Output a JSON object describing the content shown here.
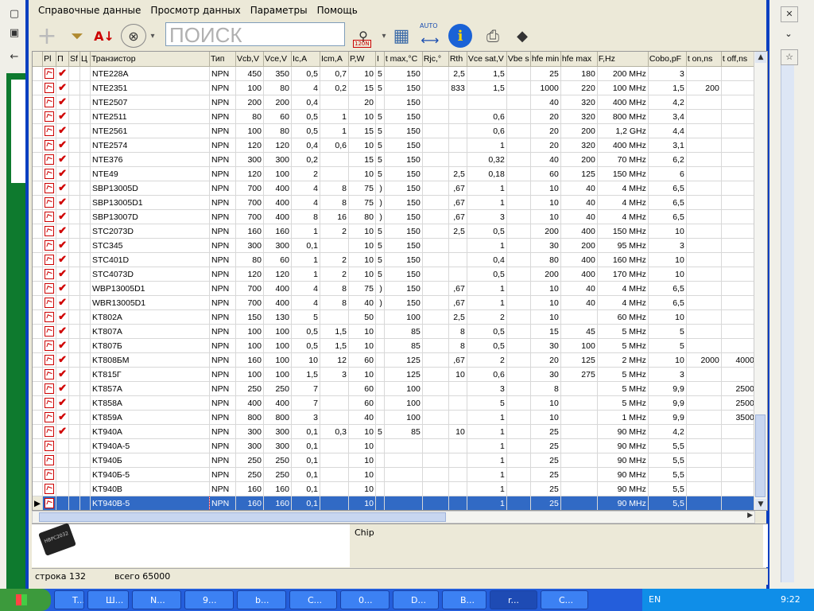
{
  "menu": [
    "Справочные данные",
    "Просмотр данных",
    "Параметры",
    "Помощь"
  ],
  "search_placeholder": "ПОИСК",
  "toolbar": {
    "auto_label": "AUTO",
    "filter_badge": "120N"
  },
  "columns": [
    "Pl",
    "П",
    "Sf",
    "Ц",
    "Транзистор",
    "Тип",
    "Vcb,V",
    "Vce,V",
    "Ic,A",
    "Icm,A",
    "P,W",
    "I",
    "t max,°C",
    "Rjc,°",
    "Rth",
    "Vce sat,V",
    "Vbe s",
    "hfe min",
    "hfe max",
    "F,Hz",
    "Cobo,pF",
    "t on,ns",
    "t off,ns"
  ],
  "rows": [
    {
      "n": "NTE228A",
      "t": "NPN",
      "vcb": "450",
      "vce": "350",
      "ic": "0,5",
      "icm": "0,7",
      "p": "10",
      "i": "5",
      "tmax": "150",
      "rjc": "",
      "rth": "2,5",
      "vsat": "1,5",
      "vbe": "",
      "hmin": "25",
      "hmax": "180",
      "f": "200 MHz",
      "cobo": "3",
      "ton": "",
      "toff": "",
      "ok": true
    },
    {
      "n": "NTE2351",
      "t": "NPN",
      "vcb": "100",
      "vce": "80",
      "ic": "4",
      "icm": "0,2",
      "p": "15",
      "i": "5",
      "tmax": "150",
      "rjc": "",
      "rth": "833",
      "vsat": "1,5",
      "vbe": "",
      "hmin": "1000",
      "hmax": "220",
      "f": "100 MHz",
      "cobo": "1,5",
      "ton": "200",
      "toff": "",
      "ok": true
    },
    {
      "n": "NTE2507",
      "t": "NPN",
      "vcb": "200",
      "vce": "200",
      "ic": "0,4",
      "icm": "",
      "p": "20",
      "i": "",
      "tmax": "150",
      "rjc": "",
      "rth": "",
      "vsat": "",
      "vbe": "",
      "hmin": "40",
      "hmax": "320",
      "f": "400 MHz",
      "cobo": "4,2",
      "ton": "",
      "toff": "",
      "ok": true
    },
    {
      "n": "NTE2511",
      "t": "NPN",
      "vcb": "80",
      "vce": "60",
      "ic": "0,5",
      "icm": "1",
      "p": "10",
      "i": "5",
      "tmax": "150",
      "rjc": "",
      "rth": "",
      "vsat": "0,6",
      "vbe": "",
      "hmin": "20",
      "hmax": "320",
      "f": "800 MHz",
      "cobo": "3,4",
      "ton": "",
      "toff": "",
      "ok": true
    },
    {
      "n": "NTE2561",
      "t": "NPN",
      "vcb": "100",
      "vce": "80",
      "ic": "0,5",
      "icm": "1",
      "p": "15",
      "i": "5",
      "tmax": "150",
      "rjc": "",
      "rth": "",
      "vsat": "0,6",
      "vbe": "",
      "hmin": "20",
      "hmax": "200",
      "f": "1,2 GHz",
      "cobo": "4,4",
      "ton": "",
      "toff": "",
      "ok": true
    },
    {
      "n": "NTE2574",
      "t": "NPN",
      "vcb": "120",
      "vce": "120",
      "ic": "0,4",
      "icm": "0,6",
      "p": "10",
      "i": "5",
      "tmax": "150",
      "rjc": "",
      "rth": "",
      "vsat": "1",
      "vbe": "",
      "hmin": "20",
      "hmax": "320",
      "f": "400 MHz",
      "cobo": "3,1",
      "ton": "",
      "toff": "",
      "ok": true
    },
    {
      "n": "NTE376",
      "t": "NPN",
      "vcb": "300",
      "vce": "300",
      "ic": "0,2",
      "icm": "",
      "p": "15",
      "i": "5",
      "tmax": "150",
      "rjc": "",
      "rth": "",
      "vsat": "0,32",
      "vbe": "",
      "hmin": "40",
      "hmax": "200",
      "f": "70 MHz",
      "cobo": "6,2",
      "ton": "",
      "toff": "",
      "ok": true
    },
    {
      "n": "NTE49",
      "t": "NPN",
      "vcb": "120",
      "vce": "100",
      "ic": "2",
      "icm": "",
      "p": "10",
      "i": "5",
      "tmax": "150",
      "rjc": "",
      "rth": "2,5",
      "vsat": "0,18",
      "vbe": "",
      "hmin": "60",
      "hmax": "125",
      "f": "150 MHz",
      "cobo": "6",
      "ton": "",
      "toff": "",
      "ok": true
    },
    {
      "n": "SBP13005D",
      "t": "NPN",
      "vcb": "700",
      "vce": "400",
      "ic": "4",
      "icm": "8",
      "p": "75",
      "i": ")",
      "tmax": "150",
      "rjc": "",
      "rth": ",67",
      "vsat": "1",
      "vbe": "",
      "hmin": "10",
      "hmax": "40",
      "f": "4 MHz",
      "cobo": "6,5",
      "ton": "",
      "toff": "",
      "ok": true
    },
    {
      "n": "SBP13005D1",
      "t": "NPN",
      "vcb": "700",
      "vce": "400",
      "ic": "4",
      "icm": "8",
      "p": "75",
      "i": ")",
      "tmax": "150",
      "rjc": "",
      "rth": ",67",
      "vsat": "1",
      "vbe": "",
      "hmin": "10",
      "hmax": "40",
      "f": "4 MHz",
      "cobo": "6,5",
      "ton": "",
      "toff": "",
      "ok": true
    },
    {
      "n": "SBP13007D",
      "t": "NPN",
      "vcb": "700",
      "vce": "400",
      "ic": "8",
      "icm": "16",
      "p": "80",
      "i": ")",
      "tmax": "150",
      "rjc": "",
      "rth": ",67",
      "vsat": "3",
      "vbe": "",
      "hmin": "10",
      "hmax": "40",
      "f": "4 MHz",
      "cobo": "6,5",
      "ton": "",
      "toff": "",
      "ok": true
    },
    {
      "n": "STC2073D",
      "t": "NPN",
      "vcb": "160",
      "vce": "160",
      "ic": "1",
      "icm": "2",
      "p": "10",
      "i": "5",
      "tmax": "150",
      "rjc": "",
      "rth": "2,5",
      "vsat": "0,5",
      "vbe": "",
      "hmin": "200",
      "hmax": "400",
      "f": "150 MHz",
      "cobo": "10",
      "ton": "",
      "toff": "",
      "ok": true
    },
    {
      "n": "STC345",
      "t": "NPN",
      "vcb": "300",
      "vce": "300",
      "ic": "0,1",
      "icm": "",
      "p": "10",
      "i": "5",
      "tmax": "150",
      "rjc": "",
      "rth": "",
      "vsat": "1",
      "vbe": "",
      "hmin": "30",
      "hmax": "200",
      "f": "95 MHz",
      "cobo": "3",
      "ton": "",
      "toff": "",
      "ok": true
    },
    {
      "n": "STC401D",
      "t": "NPN",
      "vcb": "80",
      "vce": "60",
      "ic": "1",
      "icm": "2",
      "p": "10",
      "i": "5",
      "tmax": "150",
      "rjc": "",
      "rth": "",
      "vsat": "0,4",
      "vbe": "",
      "hmin": "80",
      "hmax": "400",
      "f": "160 MHz",
      "cobo": "10",
      "ton": "",
      "toff": "",
      "ok": true
    },
    {
      "n": "STC4073D",
      "t": "NPN",
      "vcb": "120",
      "vce": "120",
      "ic": "1",
      "icm": "2",
      "p": "10",
      "i": "5",
      "tmax": "150",
      "rjc": "",
      "rth": "",
      "vsat": "0,5",
      "vbe": "",
      "hmin": "200",
      "hmax": "400",
      "f": "170 MHz",
      "cobo": "10",
      "ton": "",
      "toff": "",
      "ok": true
    },
    {
      "n": "WBP13005D1",
      "t": "NPN",
      "vcb": "700",
      "vce": "400",
      "ic": "4",
      "icm": "8",
      "p": "75",
      "i": ")",
      "tmax": "150",
      "rjc": "",
      "rth": ",67",
      "vsat": "1",
      "vbe": "",
      "hmin": "10",
      "hmax": "40",
      "f": "4 MHz",
      "cobo": "6,5",
      "ton": "",
      "toff": "",
      "ok": true
    },
    {
      "n": "WBR13005D1",
      "t": "NPN",
      "vcb": "700",
      "vce": "400",
      "ic": "4",
      "icm": "8",
      "p": "40",
      "i": ")",
      "tmax": "150",
      "rjc": "",
      "rth": ",67",
      "vsat": "1",
      "vbe": "",
      "hmin": "10",
      "hmax": "40",
      "f": "4 MHz",
      "cobo": "6,5",
      "ton": "",
      "toff": "",
      "ok": true
    },
    {
      "n": "KT802A",
      "t": "NPN",
      "vcb": "150",
      "vce": "130",
      "ic": "5",
      "icm": "",
      "p": "50",
      "i": "",
      "tmax": "100",
      "rjc": "",
      "rth": "2,5",
      "vsat": "2",
      "vbe": "",
      "hmin": "10",
      "hmax": "",
      "f": "60 MHz",
      "cobo": "10",
      "ton": "",
      "toff": "",
      "ok": true
    },
    {
      "n": "KT807A",
      "t": "NPN",
      "vcb": "100",
      "vce": "100",
      "ic": "0,5",
      "icm": "1,5",
      "p": "10",
      "i": "",
      "tmax": "85",
      "rjc": "",
      "rth": "8",
      "vsat": "0,5",
      "vbe": "",
      "hmin": "15",
      "hmax": "45",
      "f": "5 MHz",
      "cobo": "5",
      "ton": "",
      "toff": "",
      "ok": true
    },
    {
      "n": "KT807Б",
      "t": "NPN",
      "vcb": "100",
      "vce": "100",
      "ic": "0,5",
      "icm": "1,5",
      "p": "10",
      "i": "",
      "tmax": "85",
      "rjc": "",
      "rth": "8",
      "vsat": "0,5",
      "vbe": "",
      "hmin": "30",
      "hmax": "100",
      "f": "5 MHz",
      "cobo": "5",
      "ton": "",
      "toff": "",
      "ok": true
    },
    {
      "n": "KT808БМ",
      "t": "NPN",
      "vcb": "160",
      "vce": "100",
      "ic": "10",
      "icm": "12",
      "p": "60",
      "i": "",
      "tmax": "125",
      "rjc": "",
      "rth": ",67",
      "vsat": "2",
      "vbe": "",
      "hmin": "20",
      "hmax": "125",
      "f": "2 MHz",
      "cobo": "10",
      "ton": "2000",
      "toff": "4000",
      "ok": true
    },
    {
      "n": "KT815Г",
      "t": "NPN",
      "vcb": "100",
      "vce": "100",
      "ic": "1,5",
      "icm": "3",
      "p": "10",
      "i": "",
      "tmax": "125",
      "rjc": "",
      "rth": "10",
      "vsat": "0,6",
      "vbe": "",
      "hmin": "30",
      "hmax": "275",
      "f": "5 MHz",
      "cobo": "3",
      "ton": "",
      "toff": "",
      "ok": true
    },
    {
      "n": "KT857A",
      "t": "NPN",
      "vcb": "250",
      "vce": "250",
      "ic": "7",
      "icm": "",
      "p": "60",
      "i": "",
      "tmax": "100",
      "rjc": "",
      "rth": "",
      "vsat": "3",
      "vbe": "",
      "hmin": "8",
      "hmax": "",
      "f": "5 MHz",
      "cobo": "9,9",
      "ton": "",
      "toff": "2500",
      "ok": true
    },
    {
      "n": "KT858A",
      "t": "NPN",
      "vcb": "400",
      "vce": "400",
      "ic": "7",
      "icm": "",
      "p": "60",
      "i": "",
      "tmax": "100",
      "rjc": "",
      "rth": "",
      "vsat": "5",
      "vbe": "",
      "hmin": "10",
      "hmax": "",
      "f": "5 MHz",
      "cobo": "9,9",
      "ton": "",
      "toff": "2500",
      "ok": true
    },
    {
      "n": "KT859A",
      "t": "NPN",
      "vcb": "800",
      "vce": "800",
      "ic": "3",
      "icm": "",
      "p": "40",
      "i": "",
      "tmax": "100",
      "rjc": "",
      "rth": "",
      "vsat": "1",
      "vbe": "",
      "hmin": "10",
      "hmax": "",
      "f": "1 MHz",
      "cobo": "9,9",
      "ton": "",
      "toff": "3500",
      "ok": true
    },
    {
      "n": "KT940A",
      "t": "NPN",
      "vcb": "300",
      "vce": "300",
      "ic": "0,1",
      "icm": "0,3",
      "p": "10",
      "i": "5",
      "tmax": "85",
      "rjc": "",
      "rth": "10",
      "vsat": "1",
      "vbe": "",
      "hmin": "25",
      "hmax": "",
      "f": "90 MHz",
      "cobo": "4,2",
      "ton": "",
      "toff": "",
      "ok": true
    },
    {
      "n": "KT940A-5",
      "t": "NPN",
      "vcb": "300",
      "vce": "300",
      "ic": "0,1",
      "icm": "",
      "p": "10",
      "i": "",
      "tmax": "",
      "rjc": "",
      "rth": "",
      "vsat": "1",
      "vbe": "",
      "hmin": "25",
      "hmax": "",
      "f": "90 MHz",
      "cobo": "5,5",
      "ton": "",
      "toff": "",
      "ok": false
    },
    {
      "n": "KT940Б",
      "t": "NPN",
      "vcb": "250",
      "vce": "250",
      "ic": "0,1",
      "icm": "",
      "p": "10",
      "i": "",
      "tmax": "",
      "rjc": "",
      "rth": "",
      "vsat": "1",
      "vbe": "",
      "hmin": "25",
      "hmax": "",
      "f": "90 MHz",
      "cobo": "5,5",
      "ton": "",
      "toff": "",
      "ok": false
    },
    {
      "n": "KT940Б-5",
      "t": "NPN",
      "vcb": "250",
      "vce": "250",
      "ic": "0,1",
      "icm": "",
      "p": "10",
      "i": "",
      "tmax": "",
      "rjc": "",
      "rth": "",
      "vsat": "1",
      "vbe": "",
      "hmin": "25",
      "hmax": "",
      "f": "90 MHz",
      "cobo": "5,5",
      "ton": "",
      "toff": "",
      "ok": false
    },
    {
      "n": "KT940B",
      "t": "NPN",
      "vcb": "160",
      "vce": "160",
      "ic": "0,1",
      "icm": "",
      "p": "10",
      "i": "",
      "tmax": "",
      "rjc": "",
      "rth": "",
      "vsat": "1",
      "vbe": "",
      "hmin": "25",
      "hmax": "",
      "f": "90 MHz",
      "cobo": "5,5",
      "ton": "",
      "toff": "",
      "ok": false
    },
    {
      "n": "KT940B-5",
      "t": "NPN",
      "vcb": "160",
      "vce": "160",
      "ic": "0,1",
      "icm": "",
      "p": "10",
      "i": "",
      "tmax": "",
      "rjc": "",
      "rth": "",
      "vsat": "1",
      "vbe": "",
      "hmin": "25",
      "hmax": "",
      "f": "90 MHz",
      "cobo": "5,5",
      "ton": "",
      "toff": "",
      "ok": false,
      "selected": true
    }
  ],
  "detail": {
    "chip_label": "Chip",
    "chip_marking": "HBPC2032"
  },
  "status": {
    "row": "строка 132",
    "total": "всего 65000"
  },
  "taskbar": {
    "items": [
      "T...",
      "Ш...",
      "N...",
      "9...",
      "b...",
      "C...",
      "0...",
      "D...",
      "B...",
      "r...",
      "C..."
    ],
    "lang": "EN",
    "clock": "9:22"
  },
  "colors": {
    "selection": "#316ac5",
    "check": "#d00000",
    "titlebar": "#0a3fc0"
  }
}
